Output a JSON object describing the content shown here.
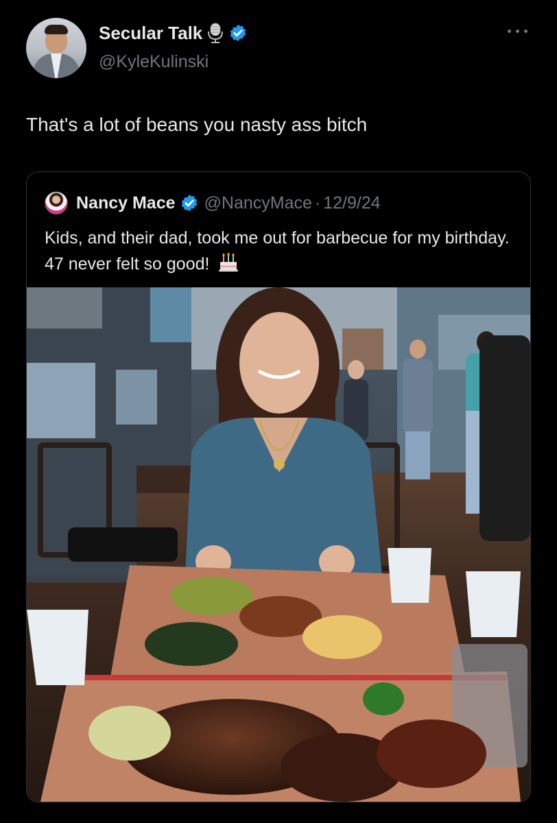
{
  "post": {
    "author": {
      "display_name": "Secular Talk",
      "handle": "@KyleKulinski",
      "verified": true,
      "name_emoji": "microphone-icon"
    },
    "text": "That's a lot of beans you nasty ass bitch",
    "more_icon": "more-options-icon"
  },
  "quote": {
    "author": {
      "display_name": "Nancy Mace",
      "handle": "@NancyMace",
      "verified": true
    },
    "separator": "·",
    "date": "12/9/24",
    "text": "Kids, and their dad, took me out for barbecue for my birthday. 47 never felt so good!",
    "emoji": "birthday-cake-icon",
    "image": "photo-woman-at-barbecue-restaurant-table"
  },
  "colors": {
    "background": "#000000",
    "text_primary": "#e7e9ea",
    "text_secondary": "#71767b",
    "border": "#2f3336",
    "verified_blue": "#1d9bf0"
  }
}
